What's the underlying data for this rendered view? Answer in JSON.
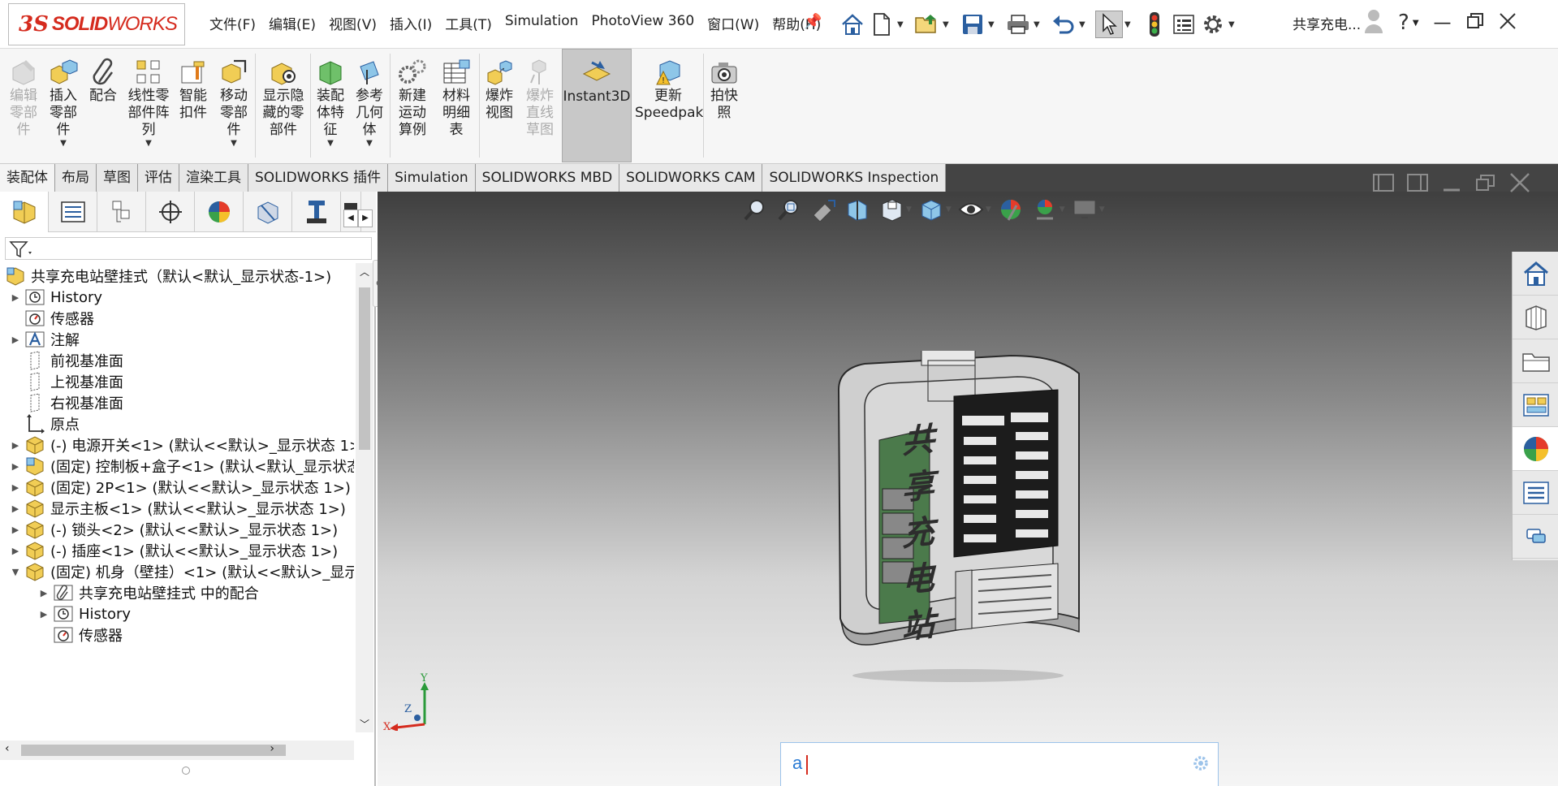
{
  "app": {
    "logo_ds": "3S",
    "logo_solid": "SOLID",
    "logo_works": "WORKS",
    "document_title": "共享充电..."
  },
  "menu": [
    "文件(F)",
    "编辑(E)",
    "视图(V)",
    "插入(I)",
    "工具(T)",
    "Simulation",
    "PhotoView 360",
    "窗口(W)",
    "帮助(H)"
  ],
  "ribbon": {
    "edit_part": "编辑\n零部\n件",
    "insert_part": "插入\n零部\n件",
    "mate": "配合",
    "linear_pattern": "线性零\n部件阵\n列",
    "smart_fasteners": "智能\n扣件",
    "move_component": "移动\n零部\n件",
    "show_hidden": "显示隐\n藏的零\n部件",
    "assembly_features": "装配\n体特\n征",
    "reference_geometry": "参考\n几何\n体",
    "new_motion_study": "新建\n运动\n算例",
    "bom": "材料\n明细\n表",
    "exploded_view": "爆炸\n视图",
    "explode_line_sketch": "爆炸\n直线\n草图",
    "instant3d": "Instant3D",
    "update_speedpak": "更新\nSpeedpak",
    "snapshot": "拍快\n照"
  },
  "tabs": [
    "装配体",
    "布局",
    "草图",
    "评估",
    "渲染工具",
    "SOLIDWORKS 插件",
    "Simulation",
    "SOLIDWORKS MBD",
    "SOLIDWORKS CAM",
    "SOLIDWORKS Inspection"
  ],
  "tree": {
    "root": "共享充电站壁挂式（默认<默认_显示状态-1>)",
    "items": [
      {
        "label": "History",
        "icon": "history-icon"
      },
      {
        "label": "传感器",
        "icon": "sensor-icon"
      },
      {
        "label": "注解",
        "icon": "annotation-icon"
      },
      {
        "label": "前视基准面",
        "icon": "plane-icon"
      },
      {
        "label": "上视基准面",
        "icon": "plane-icon"
      },
      {
        "label": "右视基准面",
        "icon": "plane-icon"
      },
      {
        "label": "原点",
        "icon": "origin-icon"
      },
      {
        "label": "(-) 电源开关<1> (默认<<默认>_显示状态 1>",
        "icon": "part-icon"
      },
      {
        "label": "(固定) 控制板+盒子<1> (默认<默认_显示状态",
        "icon": "subassembly-icon"
      },
      {
        "label": "(固定) 2P<1> (默认<<默认>_显示状态 1>)",
        "icon": "part-icon"
      },
      {
        "label": "显示主板<1> (默认<<默认>_显示状态 1>)",
        "icon": "part-icon"
      },
      {
        "label": "(-) 锁头<2> (默认<<默认>_显示状态 1>)",
        "icon": "part-icon"
      },
      {
        "label": "(-) 插座<1> (默认<<默认>_显示状态 1>)",
        "icon": "part-icon"
      },
      {
        "label": "(固定) 机身（壁挂）<1> (默认<<默认>_显示",
        "icon": "part-icon"
      },
      {
        "label": "共享充电站壁挂式 中的配合",
        "icon": "mates-icon"
      },
      {
        "label": "History",
        "icon": "history-icon"
      },
      {
        "label": "传感器",
        "icon": "sensor-icon"
      }
    ]
  },
  "model_text": [
    "共",
    "享",
    "充",
    "电",
    "站"
  ],
  "triad": {
    "x": "X",
    "y": "Y",
    "z": "Z"
  },
  "search": {
    "value": "a"
  }
}
